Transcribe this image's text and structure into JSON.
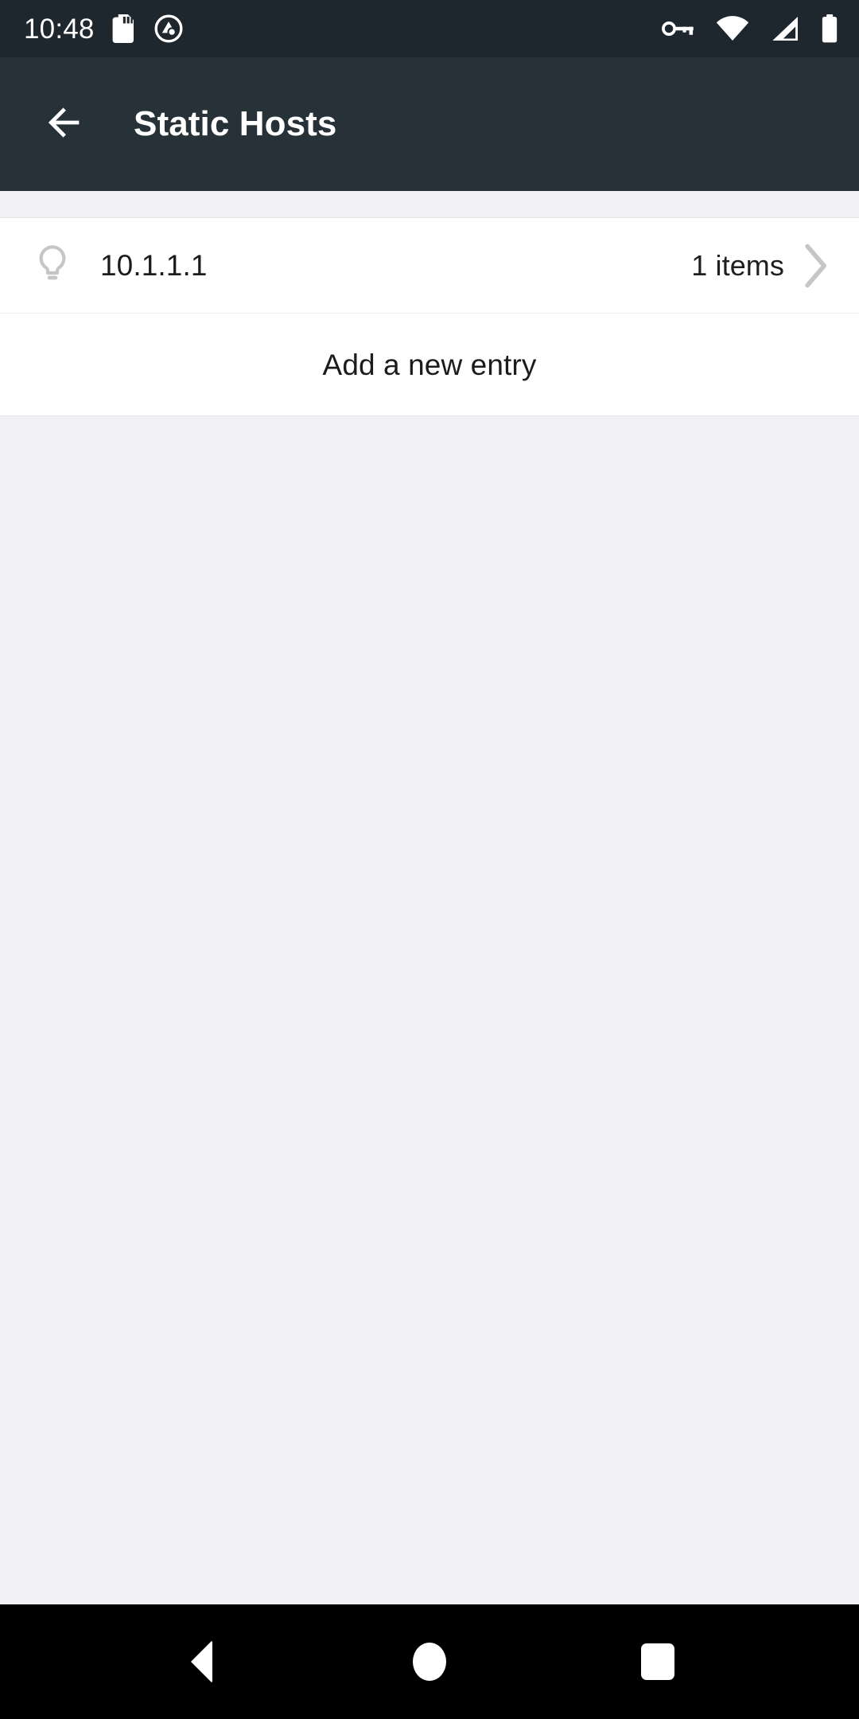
{
  "status_bar": {
    "time": "10:48",
    "left_icons": [
      "sd-card-icon",
      "adguard-logo-icon"
    ],
    "right_icons": [
      "vpn-key-icon",
      "wifi-icon",
      "cellular-signal-icon",
      "battery-icon"
    ],
    "background_color": "#1e262e",
    "foreground_color": "#ffffff"
  },
  "app_bar": {
    "title": "Static Hosts",
    "back_icon": "arrow-left-icon",
    "background_color": "#263238",
    "title_color": "#ffffff"
  },
  "list": {
    "items": [
      {
        "icon": "lightbulb-icon",
        "name": "10.1.1.1",
        "count": "1 items",
        "chevron": "chevron-right-icon"
      }
    ],
    "add_entry_label": "Add a new entry"
  },
  "nav_bar": {
    "back_label": "back-triangle-icon",
    "home_label": "home-circle-icon",
    "recents_label": "recents-square-icon",
    "background_color": "#000000"
  },
  "theme": {
    "page_background": "#f0f0f5",
    "card_background": "#ffffff",
    "primary_text": "#1c1c1c",
    "muted_icon": "#c6c6c8",
    "divider": "#eeeef1"
  }
}
